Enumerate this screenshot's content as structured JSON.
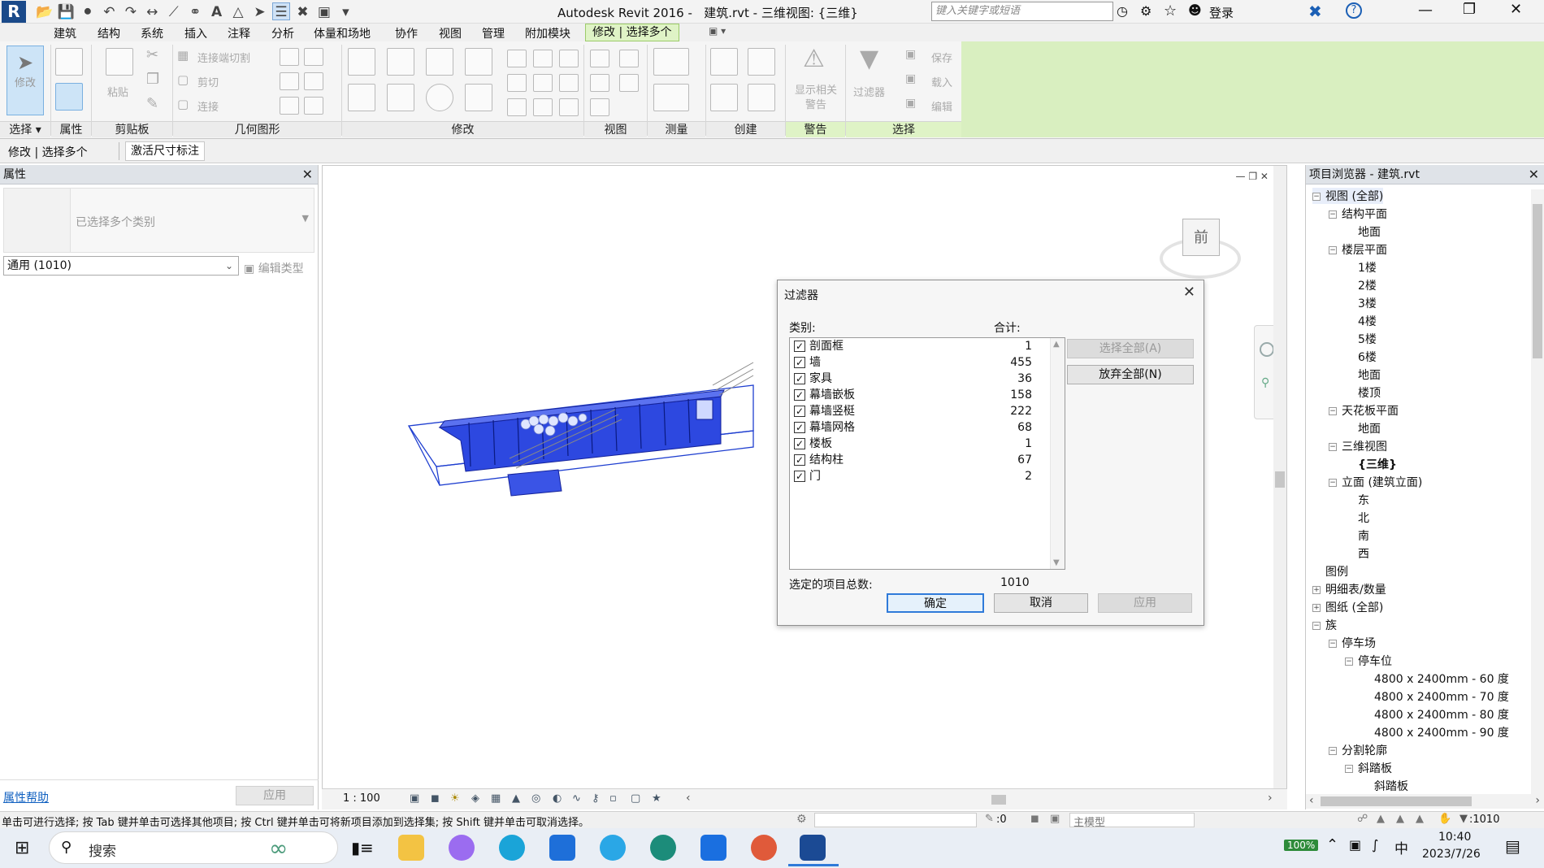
{
  "titlebar": {
    "app_title": "Autodesk Revit 2016 -",
    "doc_title": "建筑.rvt - 三维视图: {三维}",
    "search_placeholder": "键入关键字或短语",
    "login_label": "登录"
  },
  "ribbon_tabs": [
    "建筑",
    "结构",
    "系统",
    "插入",
    "注释",
    "分析",
    "体量和场地",
    "协作",
    "视图",
    "管理",
    "附加模块",
    "修改 | 选择多个"
  ],
  "ribbon": {
    "modify_label": "修改",
    "paste_label": "粘贴",
    "join_cut_label": "连接端切割",
    "cut_label": "剪切",
    "join_label": "连接",
    "show_warnings_label": "显示相关\n警告",
    "filter_label": "过滤器",
    "save_label": "保存",
    "load_label": "载入",
    "edit_label": "编辑",
    "panels": [
      "选择",
      "属性",
      "剪贴板",
      "几何图形",
      "修改",
      "视图",
      "测量",
      "创建",
      "警告",
      "选择"
    ]
  },
  "options_bar": {
    "context_label": "修改 | 选择多个",
    "activate_dim_label": "激活尺寸标注"
  },
  "properties": {
    "title": "属性",
    "type_selector": "已选择多个类别",
    "filter_dropdown": "通用 (1010)",
    "edit_type_label": "编辑类型",
    "help_link": "属性帮助",
    "apply_label": "应用"
  },
  "filter_dialog": {
    "title": "过滤器",
    "category_header": "类别:",
    "count_header": "合计:",
    "rows": [
      {
        "name": "剖面框",
        "count": "1"
      },
      {
        "name": "墙",
        "count": "455"
      },
      {
        "name": "家具",
        "count": "36"
      },
      {
        "name": "幕墙嵌板",
        "count": "158"
      },
      {
        "name": "幕墙竖梃",
        "count": "222"
      },
      {
        "name": "幕墙网格",
        "count": "68"
      },
      {
        "name": "楼板",
        "count": "1"
      },
      {
        "name": "结构柱",
        "count": "67"
      },
      {
        "name": "门",
        "count": "2"
      }
    ],
    "check_all_label": "选择全部(A)",
    "uncheck_all_label": "放弃全部(N)",
    "total_label": "选定的项目总数:",
    "total_value": "1010",
    "ok_label": "确定",
    "cancel_label": "取消",
    "apply_label": "应用"
  },
  "viewcube_face": "前",
  "view_control": {
    "scale": "1 : 100"
  },
  "project_browser": {
    "title": "项目浏览器 - 建筑.rvt",
    "items": [
      {
        "label": "视图 (全部)",
        "level": 0,
        "exp": "⊟"
      },
      {
        "label": "结构平面",
        "level": 1,
        "exp": "⊟"
      },
      {
        "label": "地面",
        "level": 2,
        "exp": ""
      },
      {
        "label": "楼层平面",
        "level": 1,
        "exp": "⊟"
      },
      {
        "label": "1楼",
        "level": 2,
        "exp": ""
      },
      {
        "label": "2楼",
        "level": 2,
        "exp": ""
      },
      {
        "label": "3楼",
        "level": 2,
        "exp": ""
      },
      {
        "label": "4楼",
        "level": 2,
        "exp": ""
      },
      {
        "label": "5楼",
        "level": 2,
        "exp": ""
      },
      {
        "label": "6楼",
        "level": 2,
        "exp": ""
      },
      {
        "label": "地面",
        "level": 2,
        "exp": ""
      },
      {
        "label": "楼顶",
        "level": 2,
        "exp": ""
      },
      {
        "label": "天花板平面",
        "level": 1,
        "exp": "⊟"
      },
      {
        "label": "地面",
        "level": 2,
        "exp": ""
      },
      {
        "label": "三维视图",
        "level": 1,
        "exp": "⊟"
      },
      {
        "label": "{三维}",
        "level": 2,
        "exp": ""
      },
      {
        "label": "立面 (建筑立面)",
        "level": 1,
        "exp": "⊟"
      },
      {
        "label": "东",
        "level": 2,
        "exp": ""
      },
      {
        "label": "北",
        "level": 2,
        "exp": ""
      },
      {
        "label": "南",
        "level": 2,
        "exp": ""
      },
      {
        "label": "西",
        "level": 2,
        "exp": ""
      },
      {
        "label": "图例",
        "level": 0,
        "exp": ""
      },
      {
        "label": "明细表/数量",
        "level": 0,
        "exp": "⊞"
      },
      {
        "label": "图纸 (全部)",
        "level": 0,
        "exp": "⊞"
      },
      {
        "label": "族",
        "level": 0,
        "exp": "⊟"
      },
      {
        "label": "停车场",
        "level": 1,
        "exp": "⊟"
      },
      {
        "label": "停车位",
        "level": 2,
        "exp": "⊟"
      },
      {
        "label": "4800 x 2400mm - 60 度",
        "level": 3,
        "exp": ""
      },
      {
        "label": "4800 x 2400mm - 70 度",
        "level": 3,
        "exp": ""
      },
      {
        "label": "4800 x 2400mm - 80 度",
        "level": 3,
        "exp": ""
      },
      {
        "label": "4800 x 2400mm - 90 度",
        "level": 3,
        "exp": ""
      },
      {
        "label": "分割轮廓",
        "level": 1,
        "exp": "⊟"
      },
      {
        "label": "斜踏板",
        "level": 2,
        "exp": "⊟"
      },
      {
        "label": "斜踏板",
        "level": 3,
        "exp": ""
      }
    ]
  },
  "status": {
    "hint": "单击可进行选择; 按 Tab 键并单击可选择其他项目; 按 Ctrl 键并单击可将新项目添加到选择集; 按 Shift 键并单击可取消选择。",
    "zero": ":0",
    "model_label": "主模型",
    "filter_count": ":1010"
  },
  "taskbar": {
    "search_label": "搜索",
    "battery": "100%",
    "ime": "中",
    "time": "10:40",
    "date": "2023/7/26"
  },
  "colors": {
    "accent": "#2f7ad9",
    "model": "#1f3fd0",
    "ribbon_active": "#dff3c6"
  }
}
